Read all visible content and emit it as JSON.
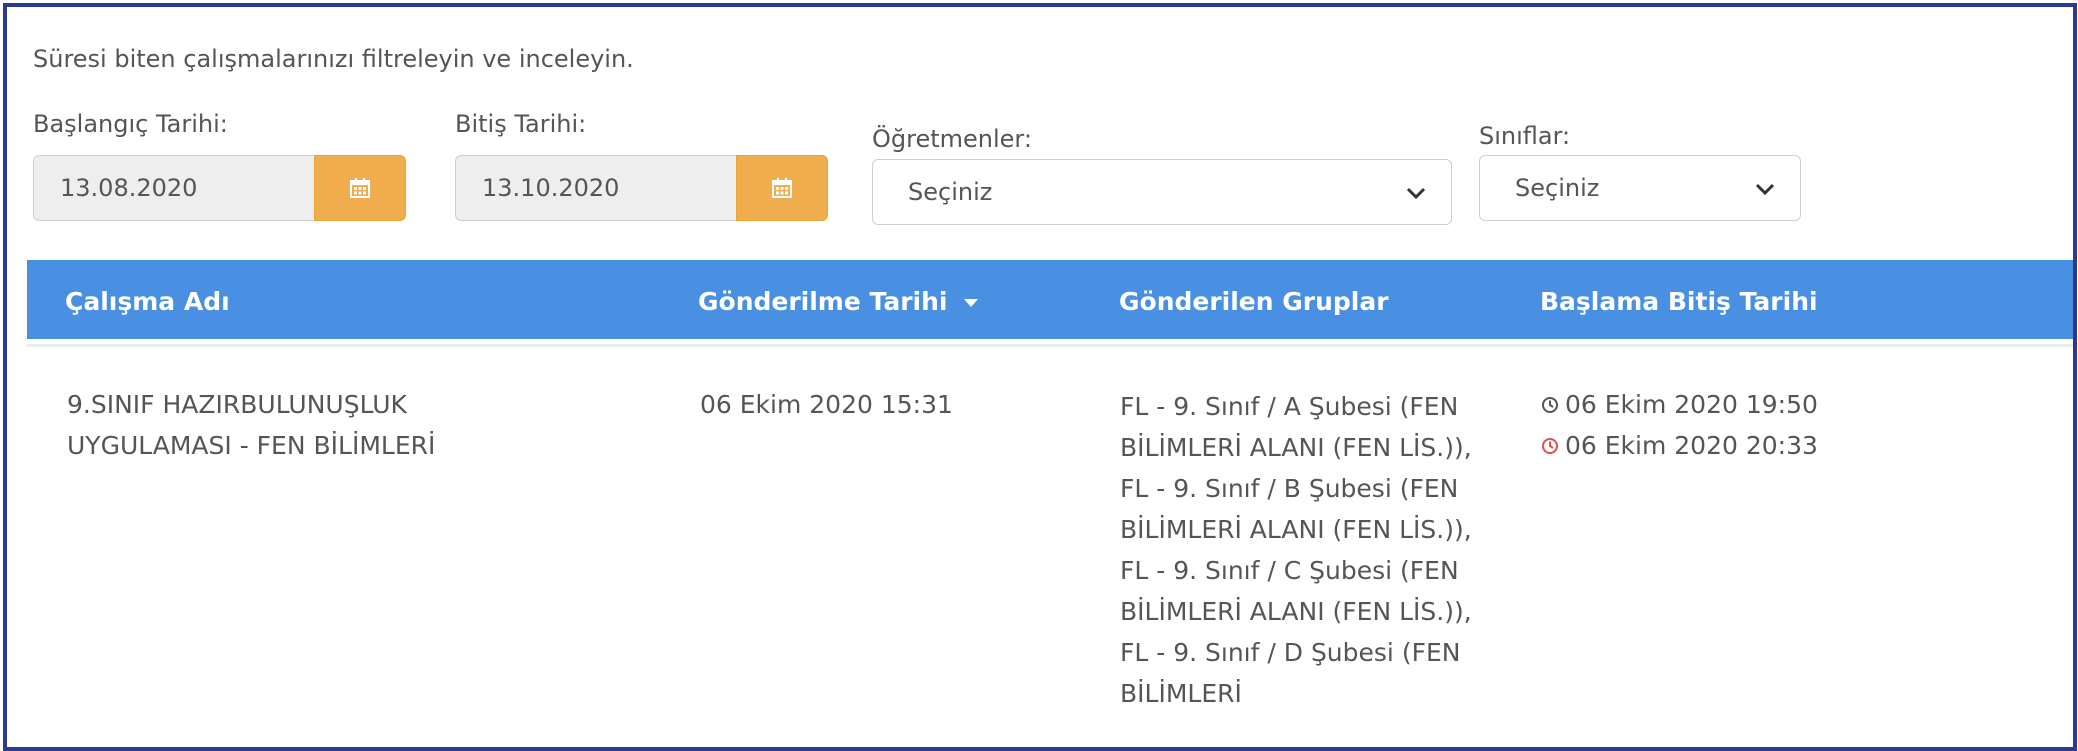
{
  "intro_text": "Süresi biten çalışmalarınızı filtreleyin ve inceleyin.",
  "filters": {
    "start_date": {
      "label": "Başlangıç Tarihi:",
      "value": "13.08.2020",
      "icon": "calendar-icon"
    },
    "end_date": {
      "label": "Bitiş Tarihi:",
      "value": "13.10.2020",
      "icon": "calendar-icon"
    },
    "teachers": {
      "label": "Öğretmenler:",
      "selected": "Seçiniz",
      "icon": "chevron-down-icon"
    },
    "classes": {
      "label": "Sınıflar:",
      "selected": "Seçiniz",
      "icon": "chevron-down-icon"
    }
  },
  "table": {
    "columns": [
      "Çalışma Adı",
      "Gönderilme Tarihi",
      "Gönderilen Gruplar",
      "Başlama Bitiş Tarihi"
    ],
    "sort_icon": "sort-down-caret-icon",
    "rows": [
      {
        "name": "9.SINIF HAZIRBULUNUŞLUK UYGULAMASI - FEN BİLİMLERİ",
        "sent_date": "06 Ekim 2020 15:31",
        "groups": "FL - 9. Sınıf / A Şubesi (FEN BİLİMLERİ ALANI (FEN LİS.)), FL - 9. Sınıf / B Şubesi (FEN BİLİMLERİ ALANI (FEN LİS.)), FL - 9. Sınıf / C Şubesi (FEN BİLİMLERİ ALANI (FEN LİS.)), FL - 9. Sınıf / D Şubesi (FEN BİLİMLERİ",
        "start": "06 Ekim 2020 19:50",
        "end": "06 Ekim 2020 20:33"
      }
    ]
  },
  "colors": {
    "header_bg": "#4a90e2",
    "calendar_button": "#f0ad4e",
    "frame_border": "#2b3a8f",
    "end_time_icon": "#d9534f",
    "start_time_icon": "#555555"
  }
}
